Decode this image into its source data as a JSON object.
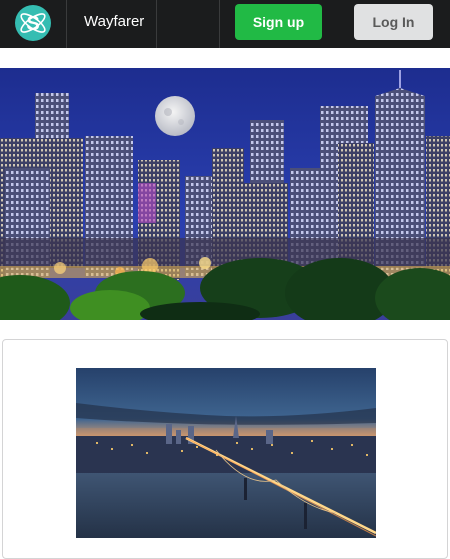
{
  "navbar": {
    "brand": "Wayfarer",
    "logo_icon": "atom-s-logo-icon",
    "signup_label": "Sign up",
    "login_label": "Log In",
    "colors": {
      "background": "#1b1c1d",
      "signup": "#21ba45",
      "login": "#e0e1e2",
      "logo": "#35bdb2"
    }
  },
  "hero": {
    "image": "denver-night-skyline-full-moon"
  },
  "card": {
    "image": "san-francisco-bay-bridge-dusk"
  }
}
